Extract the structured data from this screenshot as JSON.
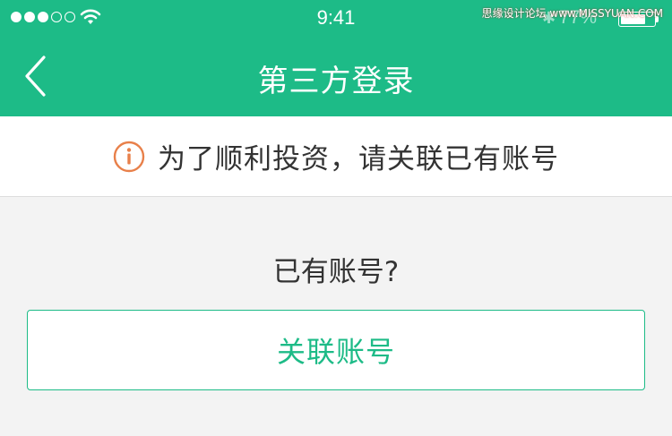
{
  "status_bar": {
    "time": "9:41",
    "battery_percent_label": "77%",
    "battery_level": 0.77,
    "signal_bars_filled": 3,
    "signal_bars_total": 5,
    "watermark": "思缘设计论坛 www.MISSYUAN.COM"
  },
  "nav": {
    "title": "第三方登录",
    "back_icon": "chevron-left-icon"
  },
  "notice": {
    "icon": "info-circle-icon",
    "text": "为了顺利投资，请关联已有账号"
  },
  "main": {
    "question": "已有账号?",
    "link_button_label": "关联账号"
  },
  "colors": {
    "brand": "#1dbb87",
    "notice_icon": "#e8804a",
    "text": "#333333",
    "background": "#f3f3f3"
  }
}
